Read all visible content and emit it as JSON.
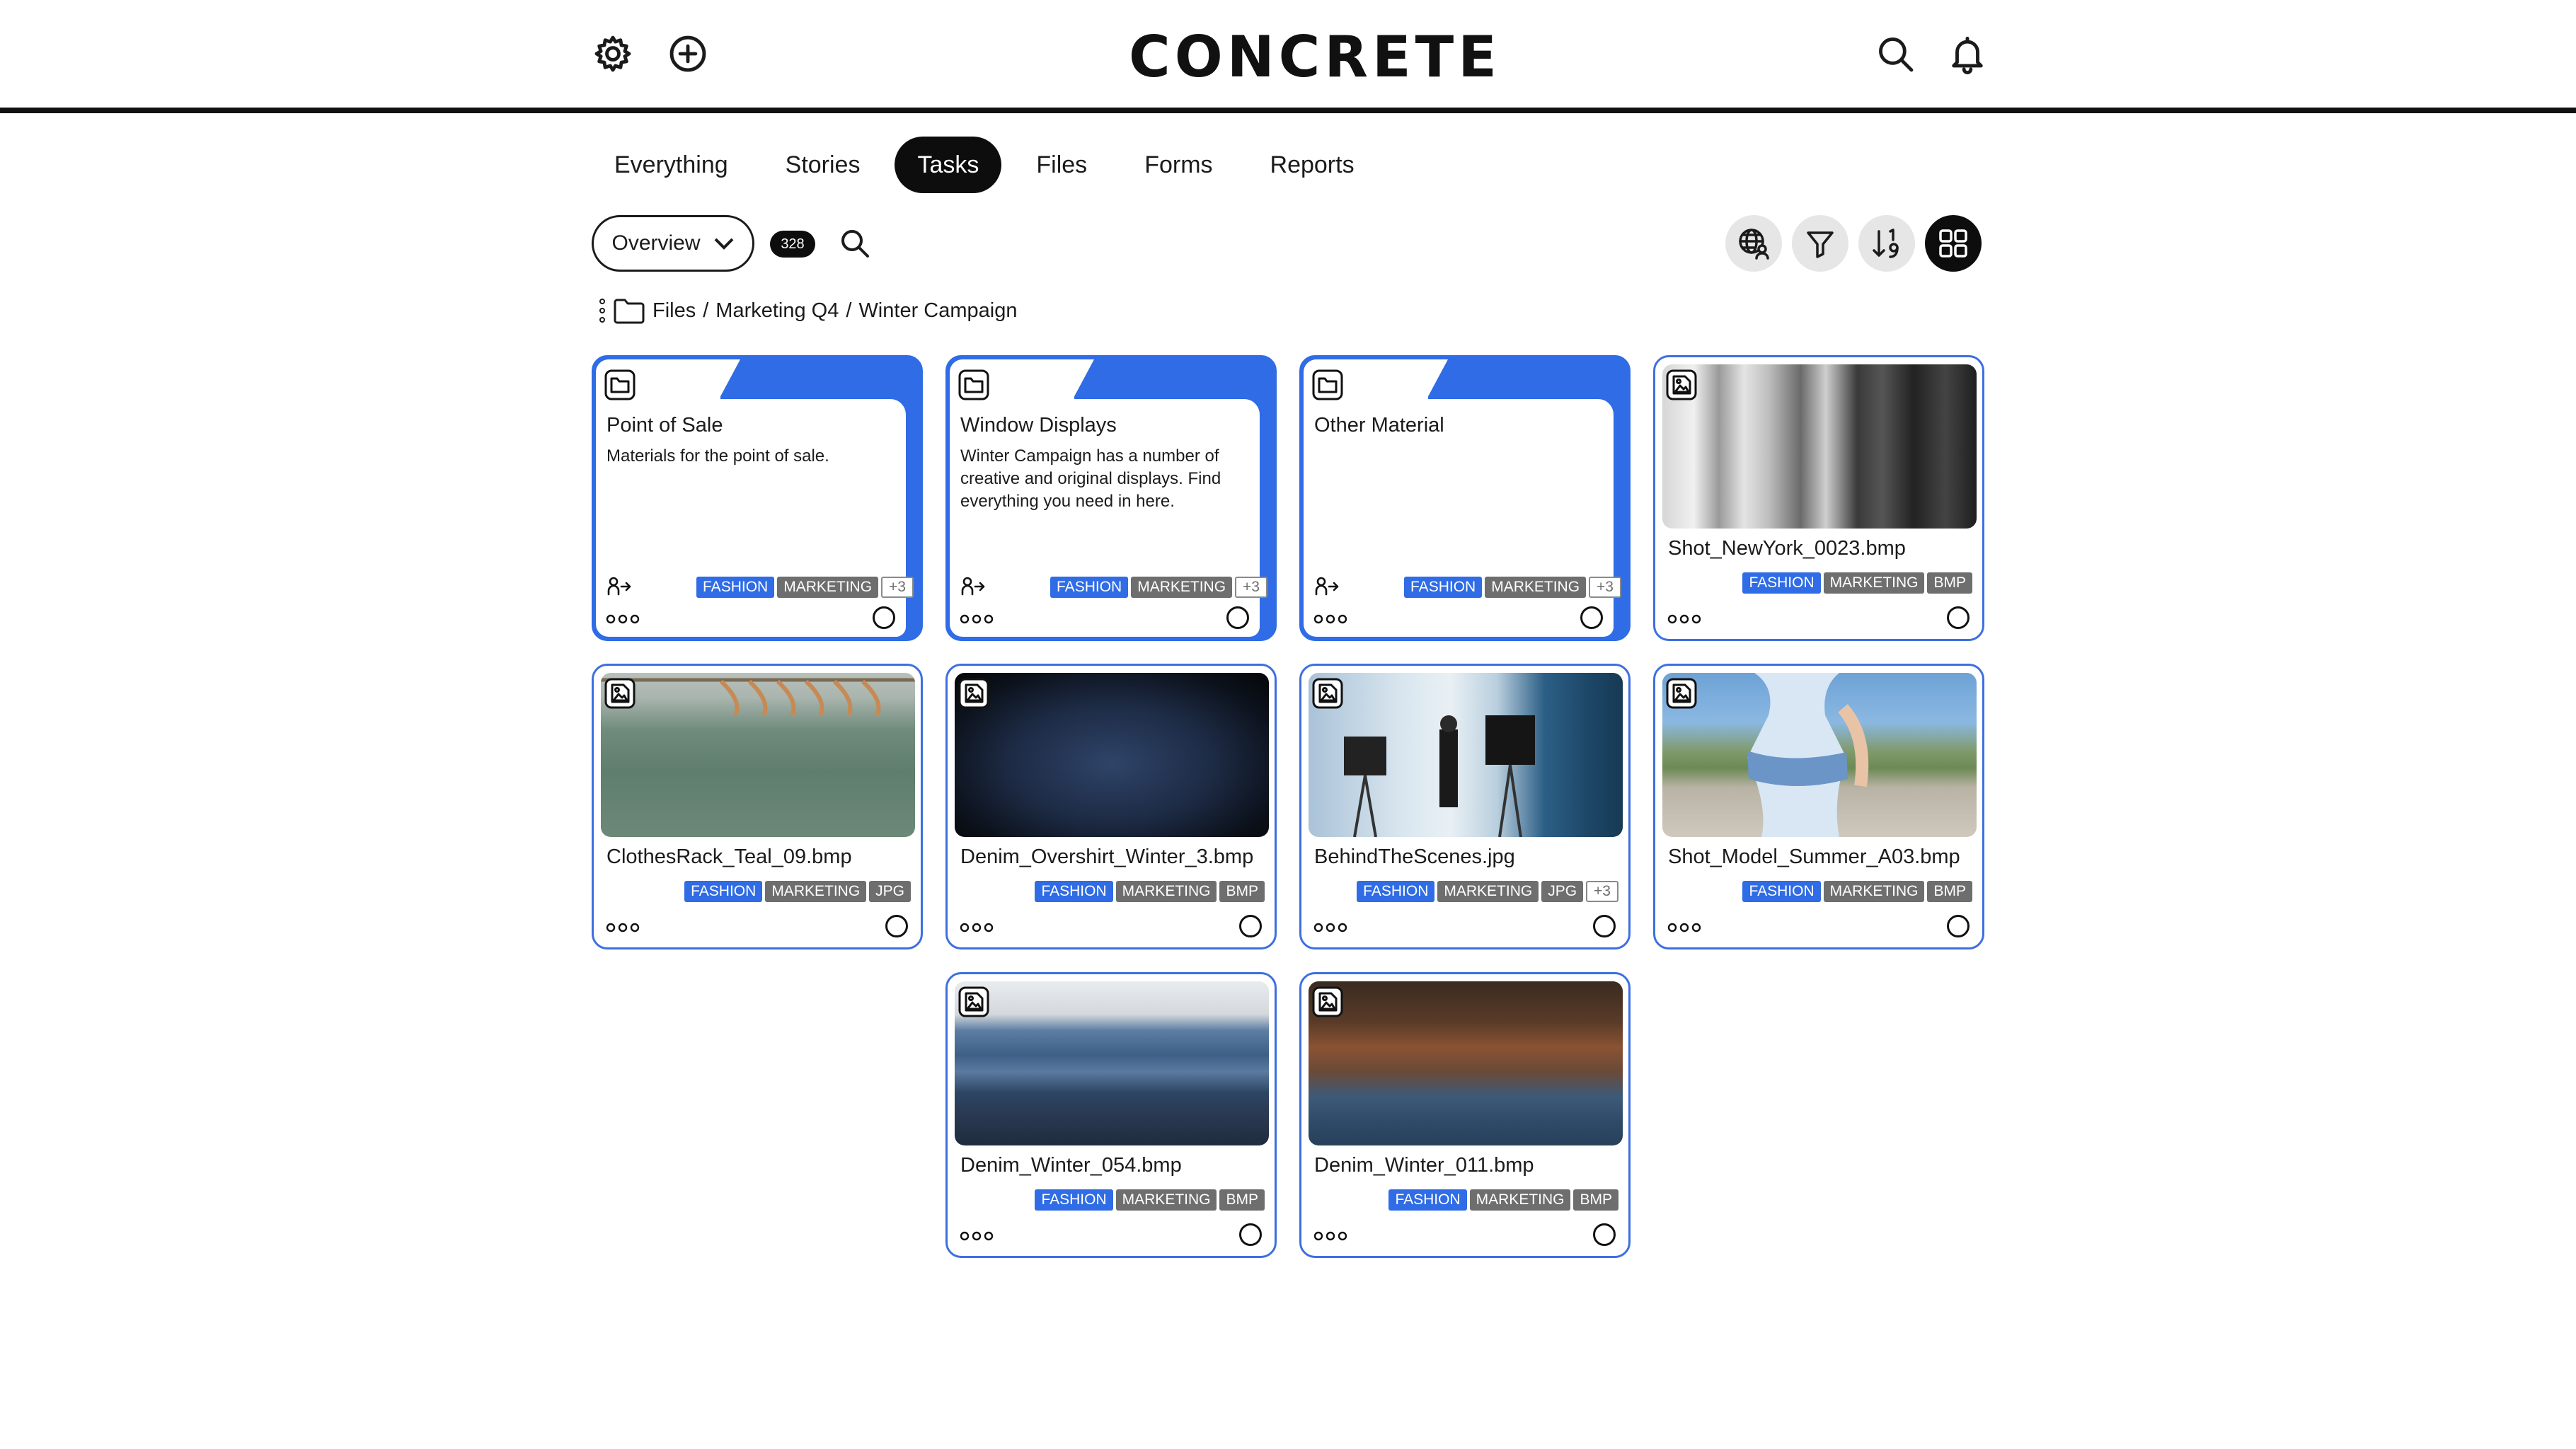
{
  "app": {
    "logo": "CONCRETE"
  },
  "header": {
    "left_icons": [
      "gear-icon",
      "plus-circle-icon"
    ],
    "right_icons": [
      "search-icon",
      "bell-icon"
    ]
  },
  "tabs": [
    {
      "label": "Everything",
      "active": false
    },
    {
      "label": "Stories",
      "active": false
    },
    {
      "label": "Tasks",
      "active": true
    },
    {
      "label": "Files",
      "active": false
    },
    {
      "label": "Forms",
      "active": false
    },
    {
      "label": "Reports",
      "active": false
    }
  ],
  "toolbar": {
    "view_select": "Overview",
    "count": "328",
    "right_icons": [
      "globe-user-icon",
      "filter-icon",
      "sort-icon",
      "grid-view-icon"
    ],
    "active_view": "grid-view-icon"
  },
  "breadcrumb": [
    "Files",
    "Marketing Q4",
    "Winter Campaign"
  ],
  "colors": {
    "accent": "#2f6ce5",
    "tag_gray": "#6e6e6e",
    "dark": "#0d0d0d"
  },
  "folders": [
    {
      "title": "Point of Sale",
      "desc": "Materials for the point of sale.",
      "tags": [
        "FASHION",
        "MARKETING"
      ],
      "more": "+3"
    },
    {
      "title": "Window Displays",
      "desc": "Winter Campaign has a number of creative and original displays. Find everything you need in here.",
      "tags": [
        "FASHION",
        "MARKETING"
      ],
      "more": "+3"
    },
    {
      "title": "Other Material",
      "desc": "",
      "tags": [
        "FASHION",
        "MARKETING"
      ],
      "more": "+3"
    }
  ],
  "files": [
    {
      "name": "Shot_NewYork_0023.bmp",
      "tags": [
        "FASHION",
        "MARKETING",
        "BMP"
      ],
      "more": ""
    },
    {
      "name": "ClothesRack_Teal_09.bmp",
      "tags": [
        "FASHION",
        "MARKETING",
        "JPG"
      ],
      "more": ""
    },
    {
      "name": "Denim_Overshirt_Winter_3.bmp",
      "tags": [
        "FASHION",
        "MARKETING",
        "BMP"
      ],
      "more": ""
    },
    {
      "name": "BehindTheScenes.jpg",
      "tags": [
        "FASHION",
        "MARKETING",
        "JPG"
      ],
      "more": "+3"
    },
    {
      "name": "Shot_Model_Summer_A03.bmp",
      "tags": [
        "FASHION",
        "MARKETING",
        "BMP"
      ],
      "more": ""
    },
    {
      "name": "Denim_Winter_054.bmp",
      "tags": [
        "FASHION",
        "MARKETING",
        "BMP"
      ],
      "more": ""
    },
    {
      "name": "Denim_Winter_011.bmp",
      "tags": [
        "FASHION",
        "MARKETING",
        "BMP"
      ],
      "more": ""
    }
  ]
}
